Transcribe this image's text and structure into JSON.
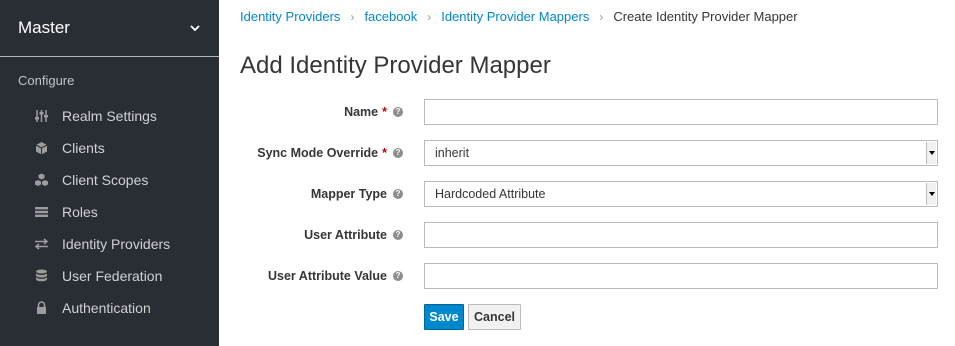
{
  "sidebar": {
    "realm": "Master",
    "section": "Configure",
    "items": [
      {
        "label": "Realm Settings",
        "icon": "sliders-icon"
      },
      {
        "label": "Clients",
        "icon": "cube-icon"
      },
      {
        "label": "Client Scopes",
        "icon": "cubes-icon"
      },
      {
        "label": "Roles",
        "icon": "list-icon"
      },
      {
        "label": "Identity Providers",
        "icon": "exchange-icon"
      },
      {
        "label": "User Federation",
        "icon": "database-icon"
      },
      {
        "label": "Authentication",
        "icon": "lock-icon"
      }
    ]
  },
  "breadcrumb": {
    "items": [
      "Identity Providers",
      "facebook",
      "Identity Provider Mappers"
    ],
    "current": "Create Identity Provider Mapper"
  },
  "page": {
    "title": "Add Identity Provider Mapper"
  },
  "form": {
    "name": {
      "label": "Name",
      "required": "*",
      "value": ""
    },
    "sync_mode": {
      "label": "Sync Mode Override",
      "required": "*",
      "value": "inherit"
    },
    "mapper_type": {
      "label": "Mapper Type",
      "value": "Hardcoded Attribute"
    },
    "user_attribute": {
      "label": "User Attribute",
      "value": ""
    },
    "user_attribute_value": {
      "label": "User Attribute Value",
      "value": ""
    },
    "help_glyph": "?",
    "save_label": "Save",
    "cancel_label": "Cancel"
  },
  "colors": {
    "sidebar_bg": "#292e34",
    "link": "#0088ce",
    "primary": "#0088ce",
    "required": "#cc0000"
  }
}
